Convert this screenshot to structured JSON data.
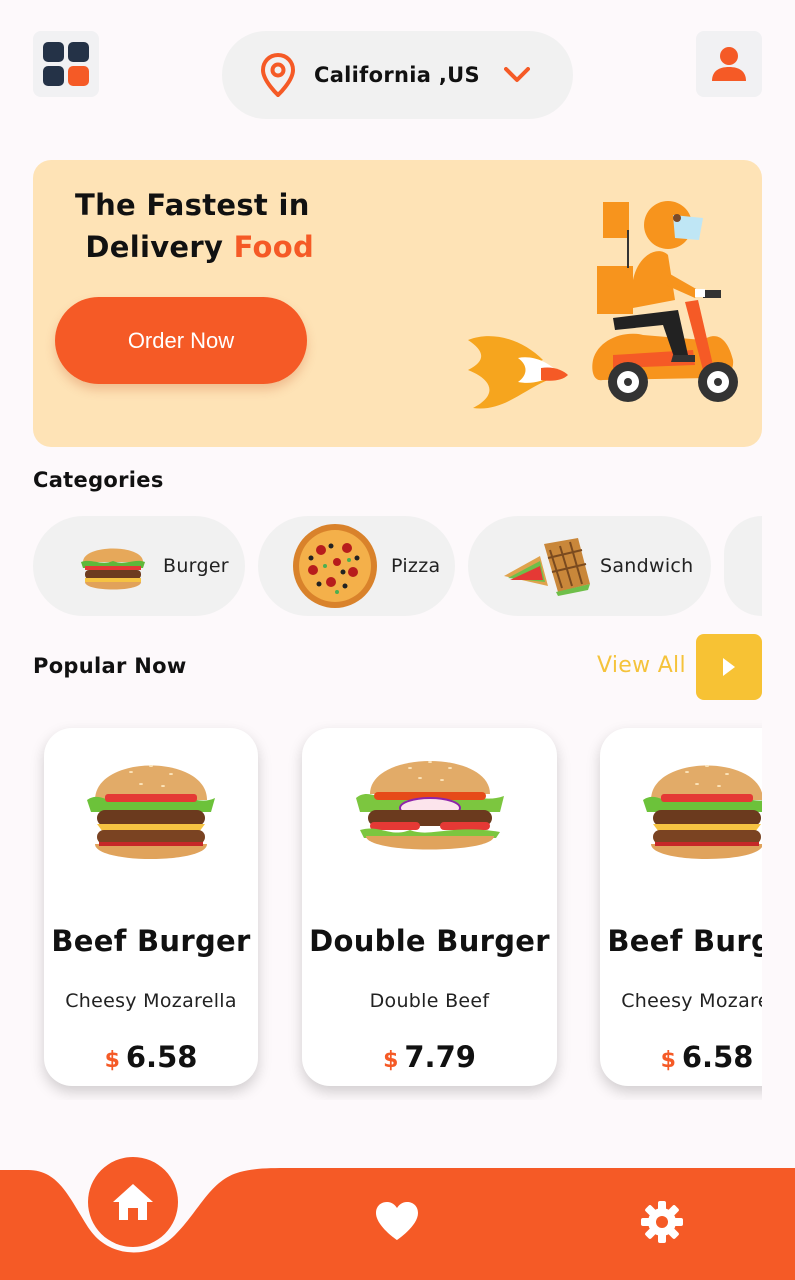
{
  "header": {
    "location": "California ,US"
  },
  "banner": {
    "title_line1": "The Fastest in",
    "title_line2_prefix": "Delivery ",
    "title_line2_accent": "Food",
    "cta_label": "Order Now"
  },
  "categories": {
    "title": "Categories",
    "items": [
      {
        "label": "Burger"
      },
      {
        "label": "Pizza"
      },
      {
        "label": "Sandwich"
      }
    ]
  },
  "popular": {
    "title": "Popular Now",
    "view_all_label": "View All",
    "items": [
      {
        "name": "Beef Burger",
        "description": "Cheesy Mozarella",
        "currency": "$",
        "price": "6.58"
      },
      {
        "name": "Double Burger",
        "description": "Double Beef",
        "currency": "$",
        "price": "7.79"
      },
      {
        "name": "Beef Burger",
        "description": "Cheesy Mozarella",
        "currency": "$",
        "price": "6.58"
      }
    ]
  },
  "nav": {
    "items": [
      {
        "icon": "home-icon",
        "active": true
      },
      {
        "icon": "heart-icon",
        "active": false
      },
      {
        "icon": "gear-icon",
        "active": false
      }
    ]
  },
  "colors": {
    "accent": "#f55a26",
    "banner_bg": "#fee3b6",
    "view_all": "#f5c33b",
    "pill_bg": "#f1f1f1"
  }
}
